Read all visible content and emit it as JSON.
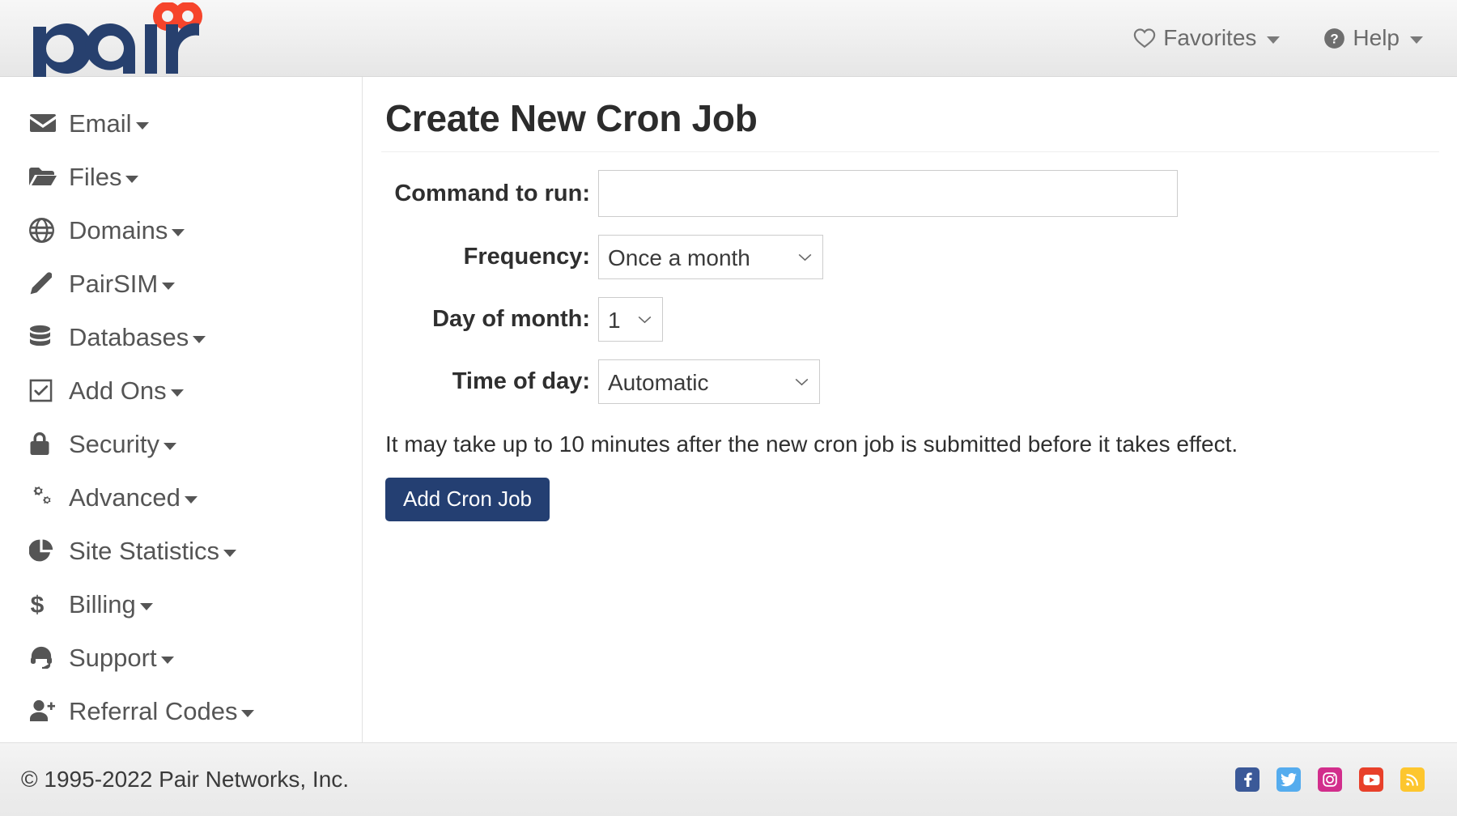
{
  "header": {
    "logo_text": "pair",
    "favorites": {
      "label": "Favorites",
      "icon": "heart-icon"
    },
    "help": {
      "label": "Help",
      "icon": "question-circle-icon"
    }
  },
  "sidebar": {
    "items": [
      {
        "label": "Email",
        "icon": "envelope-icon",
        "has_caret": true
      },
      {
        "label": "Files",
        "icon": "folder-open-icon",
        "has_caret": true
      },
      {
        "label": "Domains",
        "icon": "globe-icon",
        "has_caret": true
      },
      {
        "label": "PairSIM",
        "icon": "pen-icon",
        "has_caret": true
      },
      {
        "label": "Databases",
        "icon": "database-icon",
        "has_caret": true
      },
      {
        "label": "Add Ons",
        "icon": "check-square-icon",
        "has_caret": true
      },
      {
        "label": "Security",
        "icon": "lock-icon",
        "has_caret": true
      },
      {
        "label": "Advanced",
        "icon": "cogs-icon",
        "has_caret": true
      },
      {
        "label": "Site Statistics",
        "icon": "pie-chart-icon",
        "has_caret": true
      },
      {
        "label": "Billing",
        "icon": "dollar-icon",
        "has_caret": true
      },
      {
        "label": "Support",
        "icon": "headset-icon",
        "has_caret": true
      },
      {
        "label": "Referral Codes",
        "icon": "user-plus-icon",
        "has_caret": true
      }
    ]
  },
  "main": {
    "page_title": "Create New Cron Job",
    "fields": {
      "command": {
        "label": "Command to run:",
        "value": "",
        "placeholder": ""
      },
      "frequency": {
        "label": "Frequency:",
        "value": "Once a month",
        "options": [
          "Once a month"
        ]
      },
      "day_of_month": {
        "label": "Day of month:",
        "value": "1",
        "options": [
          "1"
        ]
      },
      "time_of_day": {
        "label": "Time of day:",
        "value": "Automatic",
        "options": [
          "Automatic"
        ]
      }
    },
    "note": "It may take up to 10 minutes after the new cron job is submitted before it takes effect.",
    "submit_label": "Add Cron Job"
  },
  "footer": {
    "copyright": "© 1995-2022 Pair Networks, Inc.",
    "socials": [
      {
        "name": "facebook",
        "color": "#3b5998"
      },
      {
        "name": "twitter",
        "color": "#55acee"
      },
      {
        "name": "instagram",
        "color": "#d22e8c"
      },
      {
        "name": "youtube",
        "color": "#e8402a"
      },
      {
        "name": "rss",
        "color": "#fdc62e"
      }
    ]
  },
  "colors": {
    "brand_navy": "#27406e",
    "brand_orange": "#f6442b",
    "button_navy": "#243f72"
  }
}
